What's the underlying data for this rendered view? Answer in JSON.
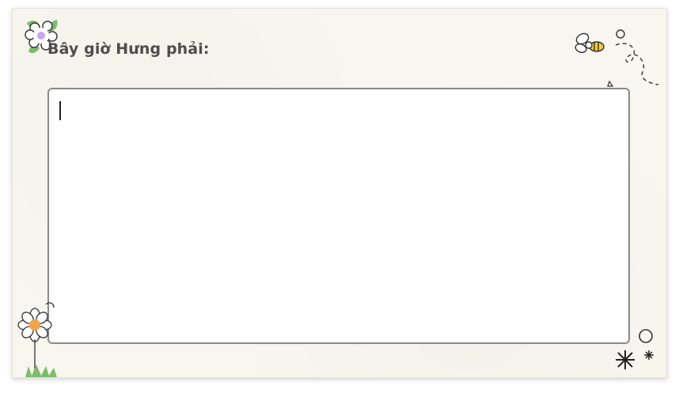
{
  "prompt": {
    "text": "Bây giờ Hưng phải:"
  },
  "answer": {
    "value": "",
    "placeholder": ""
  },
  "decorations": {
    "top_left": "flower-icon",
    "top_right": "bee-icon",
    "bottom_left": "daisy-icon",
    "bottom_right": "sparkle-icon"
  },
  "colors": {
    "card_background": "#f7f6ef",
    "prompt_text": "#4d4d4d",
    "box_border": "#8a8a8a",
    "flower_center": "#c9a5ee",
    "daisy_center": "#f3a54a",
    "leaf": "#7dbb6e",
    "bee_stripe": "#f2c93a"
  }
}
